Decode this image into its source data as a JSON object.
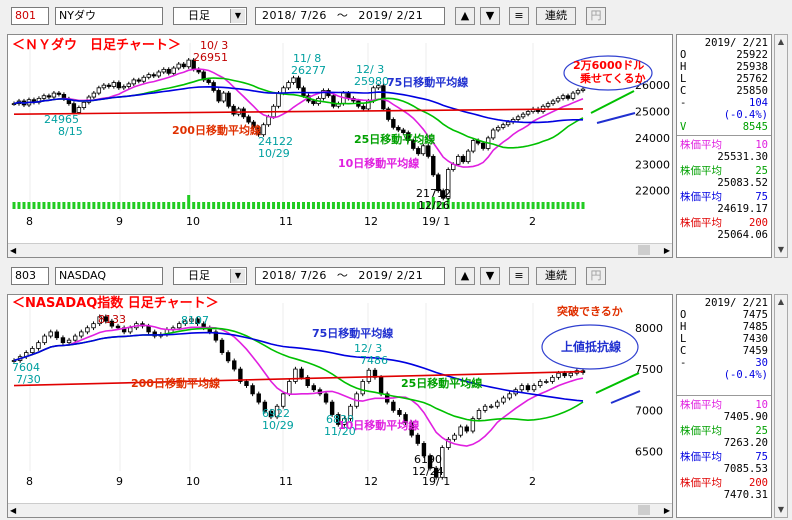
{
  "panels": [
    {
      "code": "801",
      "name": "NYダウ",
      "period": "日足",
      "date_from": "2018/ 7/26",
      "tilde": "～",
      "date_to": "2019/ 2/21",
      "renzoku": "連続",
      "yen": "円",
      "info": {
        "date": "2019/ 2/21",
        "O": "25922",
        "H": "25938",
        "L": "25762",
        "C": "25850",
        "change": "104",
        "change_pct": "(-0.4%)",
        "V": "8545",
        "ma_label": "株価平均",
        "ma10": "10",
        "ma10_val": "25531.30",
        "ma25": "25",
        "ma25_val": "25083.52",
        "ma75": "75",
        "ma75_val": "24619.17",
        "ma200": "200",
        "ma200_val": "25064.06"
      },
      "annotations": {
        "title": "＜ＮＹダウ　日足チャート＞",
        "high_date": "10/ 3",
        "high_val": "26951",
        "nov8_date": "11/ 8",
        "nov8_val": "26277",
        "dec3_date": "12/ 3",
        "dec3_val": "25980",
        "aug15_val": "24965",
        "aug15_date": "8/15",
        "oct29_val": "24122",
        "oct29_date": "10/29",
        "low_val": "21712",
        "low_date": "12/26",
        "ma75_label": "75日移動平均線",
        "ma200_label": "200日移動平均線",
        "ma25_label": "25日移動平均線",
        "ma10_label": "10日移動平均線",
        "bubble_line1": "2万6000ドル",
        "bubble_line2": "乗せてくるか"
      },
      "chart_data": {
        "type": "candlestick",
        "x_tick_labels": [
          "8",
          "9",
          "10",
          "11",
          "12",
          "19/ 1",
          "2"
        ],
        "y_tick_labels": [
          "26000",
          "25000",
          "24000",
          "23000",
          "22000"
        ],
        "ylim": [
          21000,
          27600
        ],
        "closes": [
          25300,
          25400,
          25250,
          25450,
          25350,
          25500,
          25600,
          25550,
          25700,
          25650,
          25480,
          25300,
          24965,
          25150,
          25350,
          25550,
          25700,
          25900,
          26000,
          25950,
          26100,
          25900,
          25950,
          26050,
          26200,
          26150,
          26300,
          26400,
          26350,
          26500,
          26600,
          26450,
          26650,
          26800,
          26700,
          26951,
          26600,
          26500,
          26200,
          26100,
          25800,
          25400,
          25700,
          25200,
          24900,
          25100,
          24800,
          24600,
          24400,
          24122,
          24500,
          24800,
          25200,
          25700,
          25900,
          26100,
          26277,
          25900,
          25600,
          25400,
          25300,
          25500,
          25800,
          25600,
          25200,
          25300,
          25700,
          25500,
          25400,
          25200,
          25100,
          25400,
          25900,
          25980,
          25100,
          24700,
          24400,
          24300,
          24200,
          23900,
          23600,
          23400,
          23700,
          23300,
          22600,
          22000,
          21712,
          22800,
          23000,
          23300,
          23100,
          23500,
          23900,
          23800,
          23600,
          24000,
          24300,
          24400,
          24500,
          24600,
          24700,
          24800,
          24900,
          25000,
          25100,
          25000,
          25200,
          25300,
          25400,
          25500,
          25600,
          25500,
          25700,
          25800,
          25850
        ],
        "volumes": [
          3,
          3,
          3,
          3,
          3,
          3,
          3,
          3,
          3,
          3,
          3,
          3,
          3,
          3,
          3,
          3,
          3,
          3,
          3,
          3,
          3,
          3,
          3,
          3,
          3,
          3,
          3,
          3,
          3,
          3,
          3,
          3,
          3,
          3,
          3,
          3,
          3,
          3,
          3,
          3,
          3,
          3,
          3,
          3,
          3,
          3,
          3,
          3,
          3,
          3,
          3,
          3,
          3,
          3,
          3,
          3,
          3,
          3,
          3,
          3,
          3,
          3,
          3,
          3,
          3,
          3,
          3,
          3,
          3,
          3,
          3,
          3,
          3,
          3,
          3,
          3,
          3,
          3,
          3,
          3,
          3,
          3,
          3,
          3,
          3,
          3,
          3,
          3,
          3,
          3,
          3,
          3,
          3,
          3,
          3,
          3,
          3,
          3,
          3,
          3,
          3,
          3,
          3,
          3,
          3,
          3,
          3,
          3,
          3,
          3,
          3,
          3,
          3,
          3,
          3
        ],
        "ma_colors": {
          "ma10": "#e020e0",
          "ma25": "#00c000",
          "ma75": "#0000e0",
          "ma200": "#e00000"
        }
      }
    },
    {
      "code": "803",
      "name": "NASDAQ",
      "period": "日足",
      "date_from": "2018/ 7/26",
      "tilde": "～",
      "date_to": "2019/ 2/21",
      "renzoku": "連続",
      "yen": "円",
      "info": {
        "date": "2019/ 2/21",
        "O": "7475",
        "H": "7485",
        "L": "7430",
        "C": "7459",
        "change": "30",
        "change_pct": "(-0.4%)",
        "V": "",
        "ma_label": "株価平均",
        "ma10": "10",
        "ma10_val": "7405.90",
        "ma25": "25",
        "ma25_val": "7263.20",
        "ma75": "75",
        "ma75_val": "7085.53",
        "ma200": "200",
        "ma200_val": "7470.31"
      },
      "annotations": {
        "title": "＜NASADAQ指数 日足チャート＞",
        "aug_high": "8133",
        "oct_high": "8107",
        "start_val": "7604",
        "start_date": "7/30",
        "oct29_val": "6922",
        "oct29_date": "10/29",
        "nov20_val": "6830",
        "nov20_date": "11/20",
        "dec3_date": "12/ 3",
        "dec3_val": "7486",
        "low_val": "6190",
        "low_date": "12/24",
        "ma75_label": "75日移動平均線",
        "ma200_label": "200日移動平均線",
        "ma25_label": "25日移動平均線",
        "ma10_label": "10日移動平均線",
        "breakout": "突破できるか",
        "resistance": "上値抵抗線"
      },
      "chart_data": {
        "type": "candlestick",
        "x_tick_labels": [
          "8",
          "9",
          "10",
          "11",
          "12",
          "19/ 1",
          "2"
        ],
        "y_tick_labels": [
          "8000",
          "7500",
          "7000",
          "6500"
        ],
        "ylim": [
          6000,
          8300
        ],
        "closes": [
          7604,
          7650,
          7700,
          7750,
          7820,
          7900,
          7950,
          7880,
          7820,
          7850,
          7900,
          7950,
          8000,
          8050,
          8133,
          8080,
          8020,
          8000,
          7950,
          8000,
          8050,
          8020,
          7950,
          7900,
          7920,
          7980,
          8000,
          8050,
          8080,
          8107,
          8050,
          8000,
          7950,
          7850,
          7700,
          7600,
          7500,
          7350,
          7300,
          7200,
          7100,
          6990,
          6922,
          7050,
          7200,
          7350,
          7500,
          7400,
          7300,
          7250,
          7200,
          7100,
          6950,
          6830,
          6900,
          7050,
          7200,
          7350,
          7486,
          7400,
          7200,
          7100,
          7000,
          6950,
          6850,
          6700,
          6600,
          6450,
          6300,
          6190,
          6550,
          6650,
          6700,
          6800,
          6750,
          6900,
          7000,
          7050,
          7050,
          7100,
          7150,
          7200,
          7250,
          7300,
          7250,
          7300,
          7350,
          7350,
          7400,
          7450,
          7420,
          7450,
          7480,
          7459
        ],
        "ma_colors": {
          "ma10": "#e020e0",
          "ma25": "#00c000",
          "ma75": "#0000e0",
          "ma200": "#e00000"
        }
      }
    }
  ],
  "icons": {
    "up": "up-arrow-icon",
    "down": "down-arrow-icon",
    "menu": "menu-icon"
  }
}
